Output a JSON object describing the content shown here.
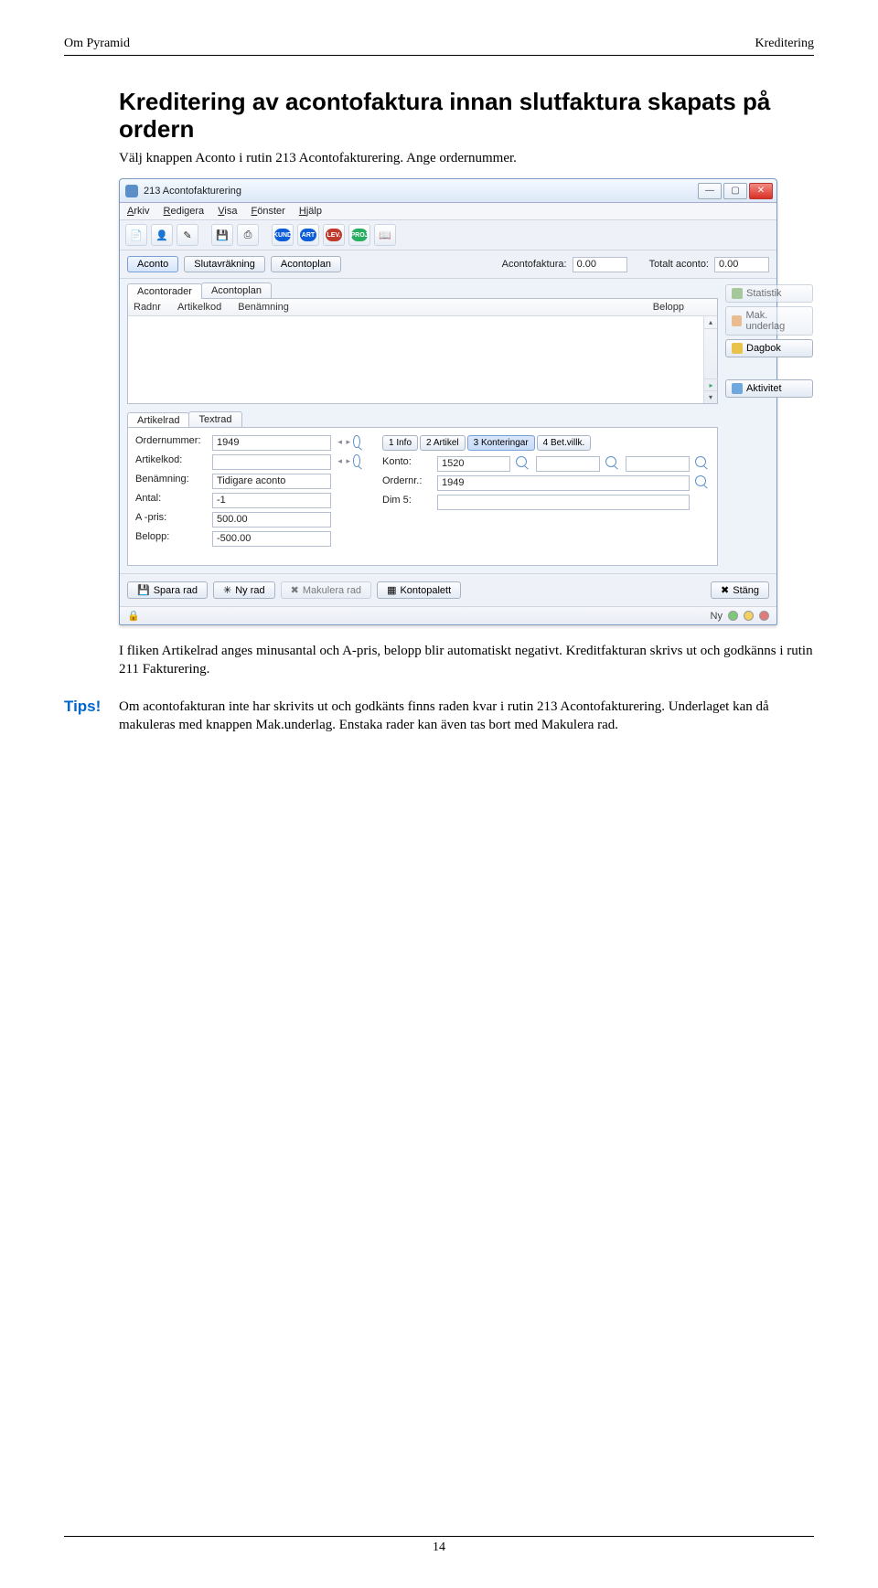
{
  "header": {
    "left": "Om Pyramid",
    "right": "Kreditering"
  },
  "h1": "Kreditering av acontofaktura innan slutfaktura skapats på ordern",
  "intro": "Välj knappen Aconto i rutin 213 Acontofakturering. Ange ordernummer.",
  "para2": "I fliken Artikelrad anges minusantal och A-pris, belopp blir automatiskt negativt. Kreditfakturan skrivs ut och godkänns i rutin 211 Fakturering.",
  "tips_label": "Tips!",
  "tips_text": "Om acontofakturan inte har skrivits ut och godkänts finns raden kvar i rutin 213 Acontofakturering. Underlaget kan då makuleras med knappen Mak.underlag. Enstaka rader kan även tas bort med Makulera rad.",
  "page_number": "14",
  "window": {
    "title": "213 Acontofakturering",
    "menus": {
      "arkiv": "Arkiv",
      "redigera": "Redigera",
      "visa": "Visa",
      "fonster": "Fönster",
      "hjalp": "Hjälp"
    },
    "chips": {
      "kund": "KUND",
      "art": "ART",
      "lev": "LEV.",
      "proj": "PROJ"
    },
    "buttons": {
      "aconto": "Aconto",
      "slutavrakning": "Slutavräkning",
      "acontoplan": "Acontoplan"
    },
    "fields_top": {
      "acontofaktura_label": "Acontofaktura:",
      "acontofaktura_val": "0.00",
      "totalt_label": "Totalt aconto:",
      "totalt_val": "0.00"
    },
    "tabs_upper": {
      "acontorader": "Acontorader",
      "acontoplan": "Acontoplan"
    },
    "list_headers": {
      "radnr": "Radnr",
      "artikelkod": "Artikelkod",
      "benamning": "Benämning",
      "belopp": "Belopp"
    },
    "side": {
      "statistik": "Statistik",
      "makunderlag": "Mak. underlag",
      "dagbok": "Dagbok",
      "aktivitet": "Aktivitet"
    },
    "tabs_lower": {
      "artikelrad": "Artikelrad",
      "textrad": "Textrad"
    },
    "form_left": {
      "ordernummer_l": "Ordernummer:",
      "ordernummer_v": "1949",
      "artikelkod_l": "Artikelkod:",
      "artikelkod_v": "",
      "benamning_l": "Benämning:",
      "benamning_v": "Tidigare aconto",
      "antal_l": "Antal:",
      "antal_v": "-1",
      "apris_l": "A -pris:",
      "apris_v": "500.00",
      "belopp_l": "Belopp:",
      "belopp_v": "-500.00"
    },
    "minitabs": {
      "info": "1 Info",
      "artikel": "2 Artikel",
      "konteringar": "3 Konteringar",
      "betvillk": "4 Bet.villk."
    },
    "form_right": {
      "konto_l": "Konto:",
      "konto_v": "1520",
      "ordernr_l": "Ordernr.:",
      "ordernr_v": "1949",
      "dim5_l": "Dim 5:"
    },
    "footer": {
      "spara": "Spara rad",
      "nyrad": "Ny rad",
      "makulera": "Makulera rad",
      "kontopalett": "Kontopalett",
      "stang": "Stäng"
    },
    "status": {
      "lock": "🔒",
      "ny": "Ny"
    }
  }
}
